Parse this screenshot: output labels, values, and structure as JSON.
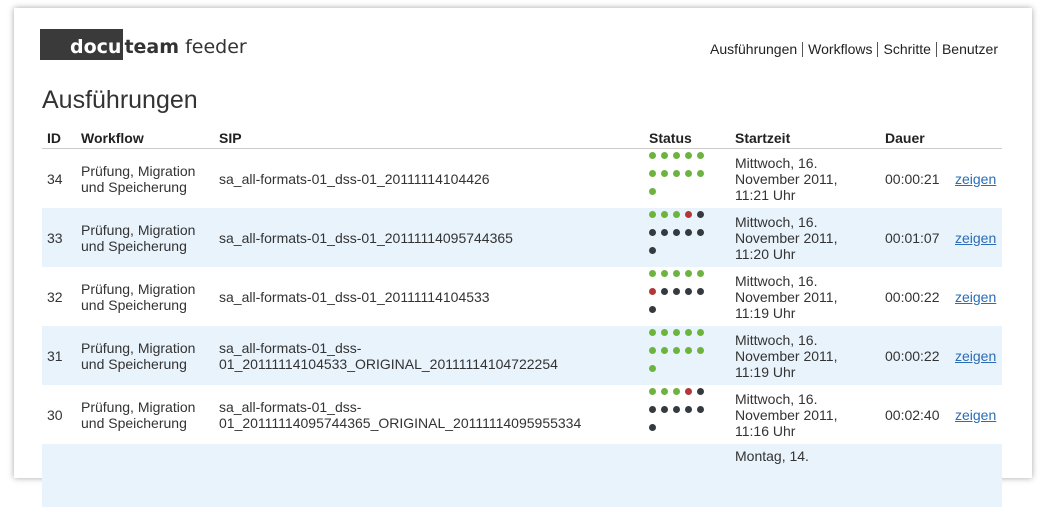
{
  "logo": {
    "box": "docu",
    "bold": "team",
    "rest": " feeder"
  },
  "nav": [
    "Ausführungen",
    "Workflows",
    "Schritte",
    "Benutzer"
  ],
  "page_title": "Ausführungen",
  "columns": [
    "ID",
    "Workflow",
    "SIP",
    "Status",
    "Startzeit",
    "Dauer"
  ],
  "status_colors": {
    "g": "#6db33f",
    "r": "#b03838",
    "k": "#333a40"
  },
  "rows": [
    {
      "id": "34",
      "workflow": "Prüfung, Migration und Speicherung",
      "sip": "sa_all-formats-01_dss-01_20111114104426",
      "status": "ggggggggggg",
      "start": "Mittwoch, 16. November 2011, 11:21 Uhr",
      "duration": "00:00:21",
      "action": "zeigen"
    },
    {
      "id": "33",
      "workflow": "Prüfung, Migration und Speicherung",
      "sip": "sa_all-formats-01_dss-01_20111114095744365",
      "status": "gggrkkkkkkk",
      "start": "Mittwoch, 16. November 2011, 11:20 Uhr",
      "duration": "00:01:07",
      "action": "zeigen"
    },
    {
      "id": "32",
      "workflow": "Prüfung, Migration und Speicherung",
      "sip": "sa_all-formats-01_dss-01_20111114104533",
      "status": "gggggrkkkkk",
      "start": "Mittwoch, 16. November 2011, 11:19 Uhr",
      "duration": "00:00:22",
      "action": "zeigen"
    },
    {
      "id": "31",
      "workflow": "Prüfung, Migration und Speicherung",
      "sip": "sa_all-formats-01_dss-01_20111114104533_ORIGINAL_20111114104722254",
      "status": "ggggggggggg",
      "start": "Mittwoch, 16. November 2011, 11:19 Uhr",
      "duration": "00:00:22",
      "action": "zeigen"
    },
    {
      "id": "30",
      "workflow": "Prüfung, Migration und Speicherung",
      "sip": "sa_all-formats-01_dss-01_20111114095744365_ORIGINAL_20111114095955334",
      "status": "gggrkkkkkkk",
      "start": "Mittwoch, 16. November 2011, 11:16 Uhr",
      "duration": "00:02:40",
      "action": "zeigen"
    }
  ],
  "partial_row_start": "Montag, 14."
}
